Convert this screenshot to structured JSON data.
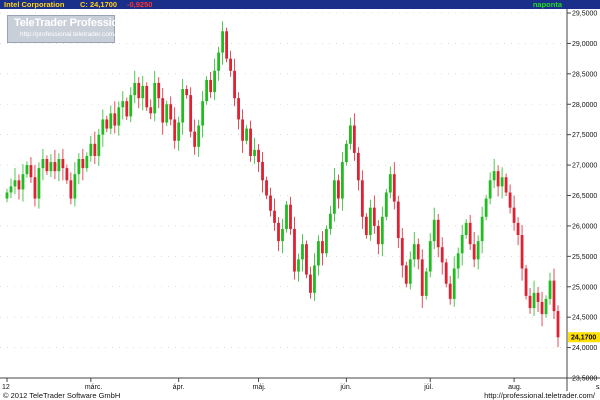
{
  "header": {
    "title": "Intel Corporation",
    "close_label": "C: 24,1700",
    "change": "-0,9250",
    "period": "naponta"
  },
  "logo": {
    "brand": "TeleTrader Professional",
    "url": "http://professional.teletrader.com/"
  },
  "footer": {
    "copyright": "© 2012 TeleTrader Software GmbH",
    "url": "http://professional.teletrader.com/"
  },
  "colors": {
    "bar": "#1a2f8a",
    "title": "#ffd21a",
    "change": "#ff3333",
    "period": "#22dd22",
    "up": "#22bb22",
    "down": "#dd2233",
    "last_price_bg": "#ffe000",
    "grid": "#c8c8c8"
  },
  "chart_data": {
    "type": "candlestick",
    "ylim": [
      23.5,
      29.5
    ],
    "ytick_labels": [
      "23,5000",
      "24,0000",
      "24,5000",
      "25,0000",
      "25,5000",
      "26,0000",
      "26,5000",
      "27,0000",
      "27,5000",
      "28,0000",
      "28,5000",
      "29,0000",
      "29,5000"
    ],
    "ytick_values": [
      23.5,
      24.0,
      24.5,
      25.0,
      25.5,
      26.0,
      26.5,
      27.0,
      27.5,
      28.0,
      28.5,
      29.0,
      29.5
    ],
    "x_labels": [
      {
        "label": "12",
        "index": 0
      },
      {
        "label": "márc.",
        "index": 21
      },
      {
        "label": "ápr.",
        "index": 43
      },
      {
        "label": "máj.",
        "index": 63
      },
      {
        "label": "jún.",
        "index": 85
      },
      {
        "label": "júl.",
        "index": 106
      },
      {
        "label": "aug.",
        "index": 127
      },
      {
        "label": "szept.",
        "index": 149
      }
    ],
    "last_price": {
      "label": "24,1700",
      "value": 24.17
    },
    "closes": [
      26.55,
      26.65,
      26.75,
      26.6,
      26.85,
      27.0,
      26.8,
      26.45,
      26.95,
      27.1,
      26.9,
      27.05,
      26.9,
      27.1,
      26.95,
      26.75,
      26.45,
      26.85,
      27.1,
      26.95,
      27.15,
      27.35,
      27.15,
      27.5,
      27.75,
      27.6,
      27.85,
      27.65,
      27.95,
      28.05,
      27.8,
      28.15,
      28.35,
      28.1,
      28.3,
      27.95,
      27.85,
      28.35,
      28.1,
      27.7,
      28.0,
      27.75,
      27.4,
      27.7,
      28.25,
      28.15,
      27.55,
      27.3,
      27.65,
      28.05,
      28.4,
      28.2,
      28.55,
      28.85,
      29.2,
      28.75,
      28.55,
      28.1,
      27.75,
      27.4,
      27.6,
      27.15,
      27.25,
      27.05,
      26.75,
      26.5,
      26.25,
      26.05,
      25.75,
      25.95,
      26.35,
      25.95,
      25.25,
      25.45,
      25.7,
      25.2,
      24.9,
      25.35,
      25.75,
      25.55,
      25.95,
      26.2,
      26.75,
      26.45,
      27.05,
      27.35,
      27.65,
      27.2,
      26.75,
      26.15,
      25.85,
      26.3,
      26.0,
      25.7,
      26.15,
      26.55,
      26.85,
      26.4,
      25.8,
      25.35,
      25.05,
      25.45,
      25.7,
      25.45,
      24.85,
      25.25,
      25.75,
      26.1,
      25.65,
      25.4,
      25.05,
      24.8,
      25.3,
      25.55,
      25.85,
      26.05,
      25.7,
      25.45,
      25.75,
      26.15,
      26.45,
      26.75,
      26.9,
      26.65,
      26.8,
      26.55,
      26.3,
      26.05,
      25.85,
      25.3,
      24.85,
      24.65,
      24.9,
      24.75,
      24.55,
      24.8,
      25.1,
      24.6,
      24.17
    ]
  }
}
